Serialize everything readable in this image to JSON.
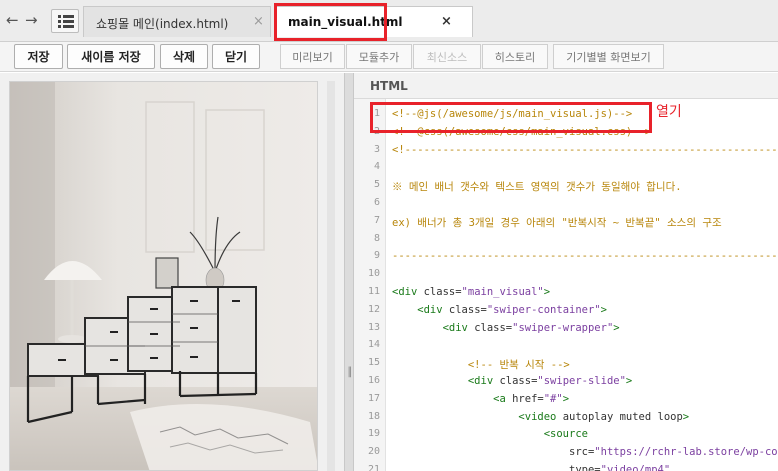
{
  "tabs": [
    {
      "label": "쇼핑몰 메인(index.html)",
      "close": "×",
      "active": false
    },
    {
      "label": "main_visual.html",
      "close": "×",
      "active": true
    }
  ],
  "nav": {
    "back": "←",
    "forward": "→"
  },
  "toolbar": {
    "save": "저장",
    "save_as": "새이름 저장",
    "delete": "삭제",
    "close": "닫기",
    "preview": "미리보기",
    "add_module": "모듈추가",
    "latest_source": "최신소스",
    "history": "히스토리",
    "device_view": "기기별별 화면보기"
  },
  "code_pane": {
    "title": "HTML",
    "lines": [
      {
        "n": "1",
        "segs": [
          {
            "t": "<!--@js(/awesome/js/main_visual.js)-->",
            "c": "c-comment"
          }
        ]
      },
      {
        "n": "2",
        "segs": [
          {
            "t": "<!--@css(/awesome/css/main_visual.css)-->",
            "c": "c-comment"
          }
        ]
      },
      {
        "n": "3",
        "segs": [
          {
            "t": "<!-------------------------------------------------------------",
            "c": "c-comment"
          }
        ]
      },
      {
        "n": "4",
        "segs": [
          {
            "t": "",
            "c": "c-plain"
          }
        ]
      },
      {
        "n": "5",
        "segs": [
          {
            "t": "※ 메인 배너 갯수와 텍스트 영역의 갯수가 동일해야 합니다.",
            "c": "c-comment"
          }
        ]
      },
      {
        "n": "6",
        "segs": [
          {
            "t": "",
            "c": "c-plain"
          }
        ]
      },
      {
        "n": "7",
        "segs": [
          {
            "t": "ex) 배너가 총 3개일 경우 아래의 \"반복시작 ~ 반복끝\" 소스의 구조",
            "c": "c-comment"
          }
        ]
      },
      {
        "n": "8",
        "segs": [
          {
            "t": "",
            "c": "c-plain"
          }
        ]
      },
      {
        "n": "9",
        "segs": [
          {
            "t": "---------------------------------------------------------------",
            "c": "c-comment"
          }
        ]
      },
      {
        "n": "10",
        "segs": [
          {
            "t": "",
            "c": "c-plain"
          }
        ]
      },
      {
        "n": "11",
        "segs": [
          {
            "t": "<div ",
            "c": "c-tag"
          },
          {
            "t": "class=",
            "c": "c-attr"
          },
          {
            "t": "\"main_visual\"",
            "c": "c-str"
          },
          {
            "t": ">",
            "c": "c-tag"
          }
        ]
      },
      {
        "n": "12",
        "segs": [
          {
            "t": "    <div ",
            "c": "c-tag"
          },
          {
            "t": "class=",
            "c": "c-attr"
          },
          {
            "t": "\"swiper-container\"",
            "c": "c-str"
          },
          {
            "t": ">",
            "c": "c-tag"
          }
        ]
      },
      {
        "n": "13",
        "segs": [
          {
            "t": "        <div ",
            "c": "c-tag"
          },
          {
            "t": "class=",
            "c": "c-attr"
          },
          {
            "t": "\"swiper-wrapper\"",
            "c": "c-str"
          },
          {
            "t": ">",
            "c": "c-tag"
          }
        ]
      },
      {
        "n": "14",
        "segs": [
          {
            "t": "",
            "c": "c-plain"
          }
        ]
      },
      {
        "n": "15",
        "segs": [
          {
            "t": "            <!-- 반복 시작 -->",
            "c": "c-comment"
          }
        ]
      },
      {
        "n": "16",
        "segs": [
          {
            "t": "            <div ",
            "c": "c-tag"
          },
          {
            "t": "class=",
            "c": "c-attr"
          },
          {
            "t": "\"swiper-slide\"",
            "c": "c-str"
          },
          {
            "t": ">",
            "c": "c-tag"
          }
        ]
      },
      {
        "n": "17",
        "segs": [
          {
            "t": "                <a ",
            "c": "c-tag"
          },
          {
            "t": "href=",
            "c": "c-attr"
          },
          {
            "t": "\"#\"",
            "c": "c-str"
          },
          {
            "t": ">",
            "c": "c-tag"
          }
        ]
      },
      {
        "n": "18",
        "segs": [
          {
            "t": "                    <video ",
            "c": "c-tag"
          },
          {
            "t": "autoplay muted loop",
            "c": "c-attr"
          },
          {
            "t": ">",
            "c": "c-tag"
          }
        ]
      },
      {
        "n": "19",
        "segs": [
          {
            "t": "                        <source",
            "c": "c-tag"
          }
        ]
      },
      {
        "n": "20",
        "segs": [
          {
            "t": "                            src=",
            "c": "c-attr"
          },
          {
            "t": "\"https://rchr-lab.store/wp-co",
            "c": "c-str"
          }
        ]
      },
      {
        "n": "21",
        "segs": [
          {
            "t": "                            type=",
            "c": "c-attr"
          },
          {
            "t": "\"video/mp4\"",
            "c": "c-str"
          }
        ]
      }
    ]
  },
  "annotation": "열기",
  "colors": {
    "highlight": "#e8222a",
    "comment": "#b8860b",
    "tag": "#1a7a1a",
    "string": "#7b3fa0"
  }
}
